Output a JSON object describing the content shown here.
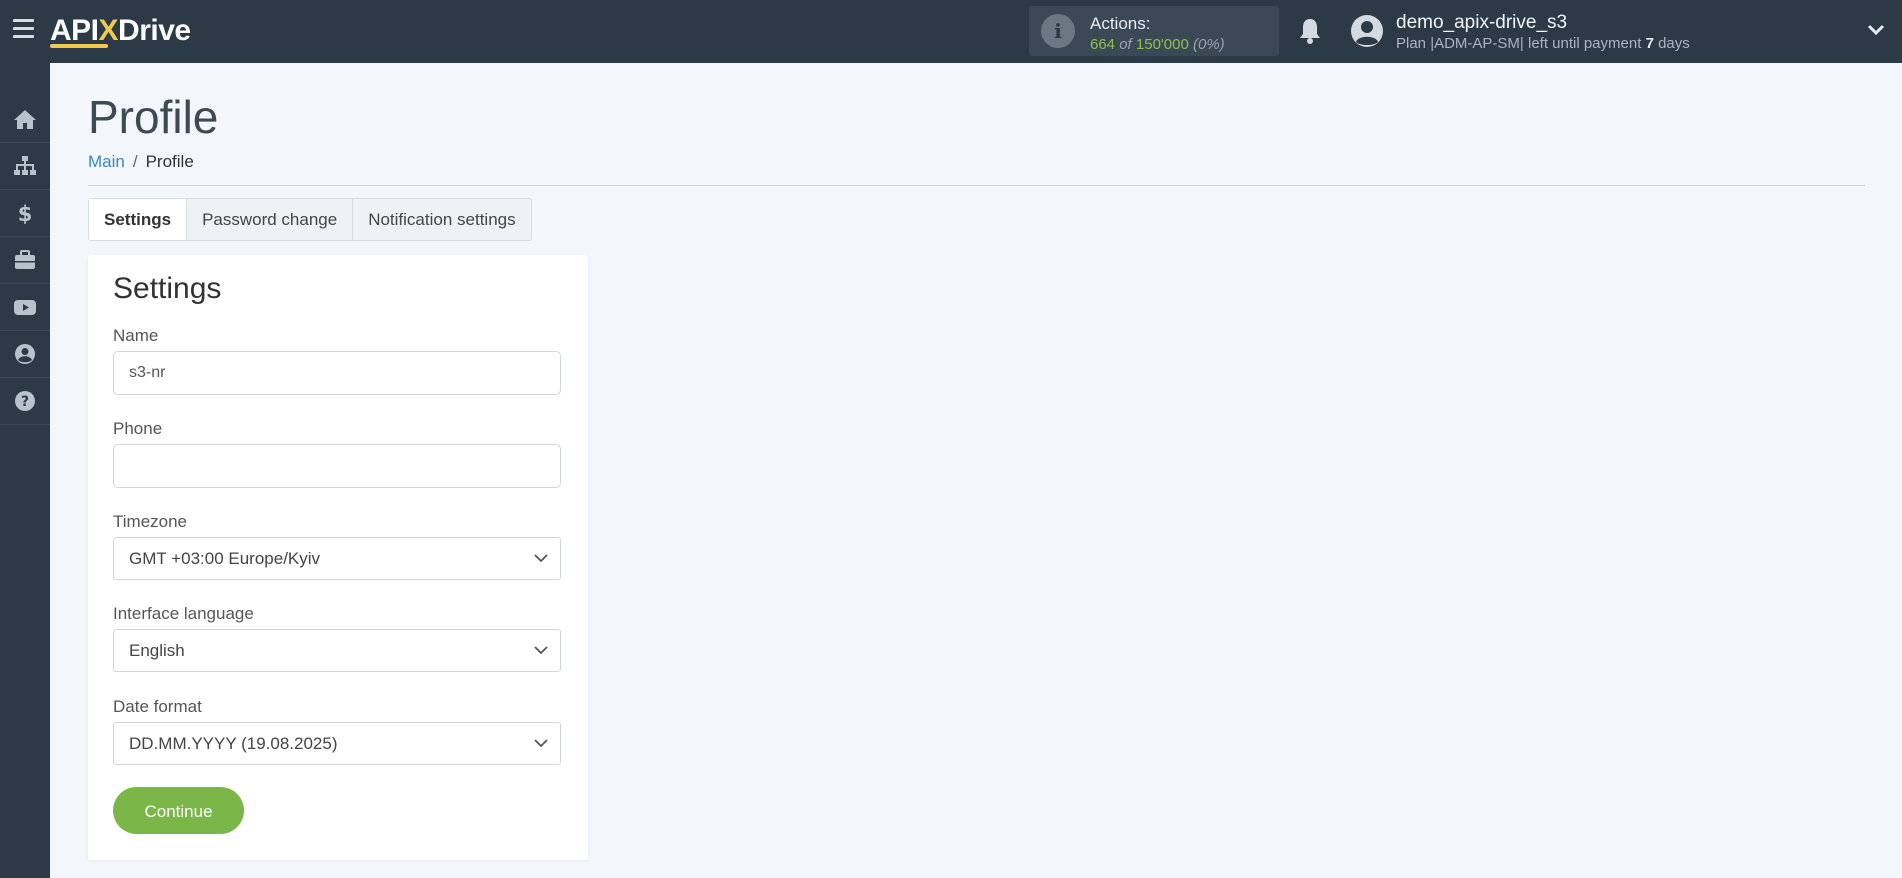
{
  "header": {
    "logo": {
      "api": "API",
      "x": "X",
      "drive": "Drive"
    },
    "actions": {
      "label": "Actions:",
      "used": "664",
      "of": "of",
      "total": "150'000",
      "percent": "(0%)"
    },
    "user": {
      "name": "demo_apix-drive_s3",
      "plan_prefix": "Plan |ADM-AP-SM| left until payment",
      "days_number": "7",
      "days_word": "days"
    },
    "icons": {
      "menu": "hamburger-icon",
      "info": "info-icon",
      "bell": "bell-icon",
      "avatar": "user-circle-icon",
      "chevron": "chevron-down-icon"
    }
  },
  "sidebar": {
    "items": [
      {
        "icon": "home-icon"
      },
      {
        "icon": "sitemap-icon"
      },
      {
        "icon": "dollar-icon"
      },
      {
        "icon": "briefcase-icon"
      },
      {
        "icon": "youtube-icon"
      },
      {
        "icon": "user-circle-icon"
      },
      {
        "icon": "question-circle-icon"
      }
    ]
  },
  "page": {
    "title": "Profile",
    "breadcrumb": {
      "main": "Main",
      "separator": "/",
      "current": "Profile"
    },
    "tabs": [
      "Settings",
      "Password change",
      "Notification settings"
    ],
    "active_tab": "Settings"
  },
  "form": {
    "title": "Settings",
    "name": {
      "label": "Name",
      "value": "s3-nr"
    },
    "phone": {
      "label": "Phone",
      "value": ""
    },
    "timezone": {
      "label": "Timezone",
      "value": "GMT +03:00 Europe/Kyiv"
    },
    "language": {
      "label": "Interface language",
      "value": "English"
    },
    "date_format": {
      "label": "Date format",
      "value": "DD.MM.YYYY (19.08.2025)"
    },
    "submit": "Continue"
  },
  "colors": {
    "topbar": "#2c3a47",
    "accent_green": "#7ab648",
    "link_blue": "#3a87c9",
    "logo_yellow": "#f2c94c",
    "background": "#f3f7fb"
  }
}
